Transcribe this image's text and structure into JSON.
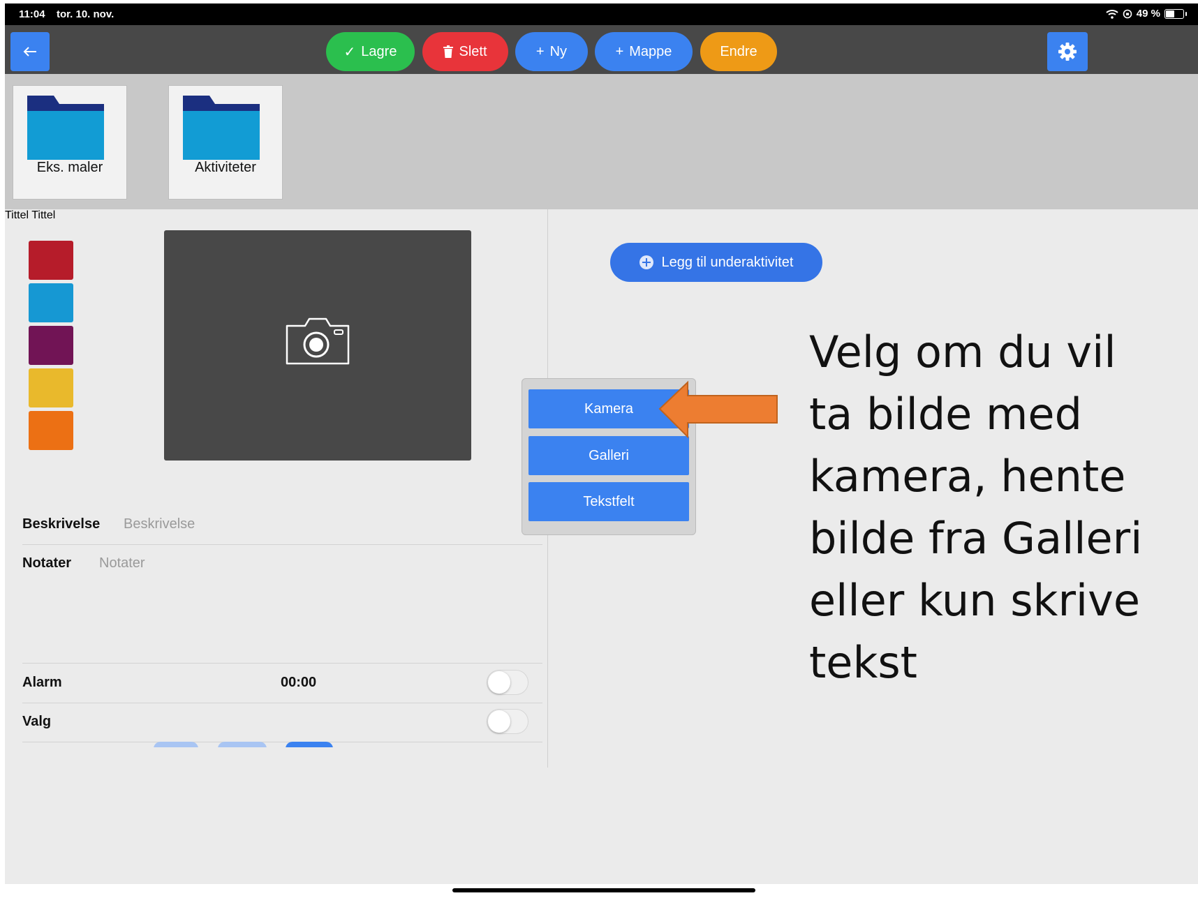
{
  "status_bar": {
    "time": "11:04",
    "date": "tor. 10. nov.",
    "battery": "49 %"
  },
  "toolbar": {
    "save_label": "Lagre",
    "delete_label": "Slett",
    "new_label": "Ny",
    "folder_label": "Mappe",
    "edit_label": "Endre"
  },
  "folders": [
    {
      "label": "Eks. maler"
    },
    {
      "label": "Aktiviteter"
    }
  ],
  "colors": {
    "swatches": [
      "#b61c2a",
      "#1698d3",
      "#711455",
      "#e9b92c",
      "#ec7014"
    ],
    "accent": "#3b82f0",
    "save": "#2bbf4e",
    "delete": "#e8343a",
    "edit": "#ee9a16",
    "arrow": "#ed7d31"
  },
  "form": {
    "title_label": "Tittel",
    "title_placeholder": "Tittel",
    "description_label": "Beskrivelse",
    "description_placeholder": "Beskrivelse",
    "notes_label": "Notater",
    "notes_placeholder": "Notater",
    "alarm_label": "Alarm",
    "alarm_time": "00:00",
    "choice_label": "Valg"
  },
  "popup": {
    "items": [
      "Kamera",
      "Galleri",
      "Tekstfelt"
    ]
  },
  "add_subactivity_label": "Legg til underaktivitet",
  "instruction_lines": [
    "Velg om du vil",
    "ta bilde med",
    "kamera, hente",
    "bilde fra Galleri",
    "eller kun skrive",
    "tekst"
  ]
}
